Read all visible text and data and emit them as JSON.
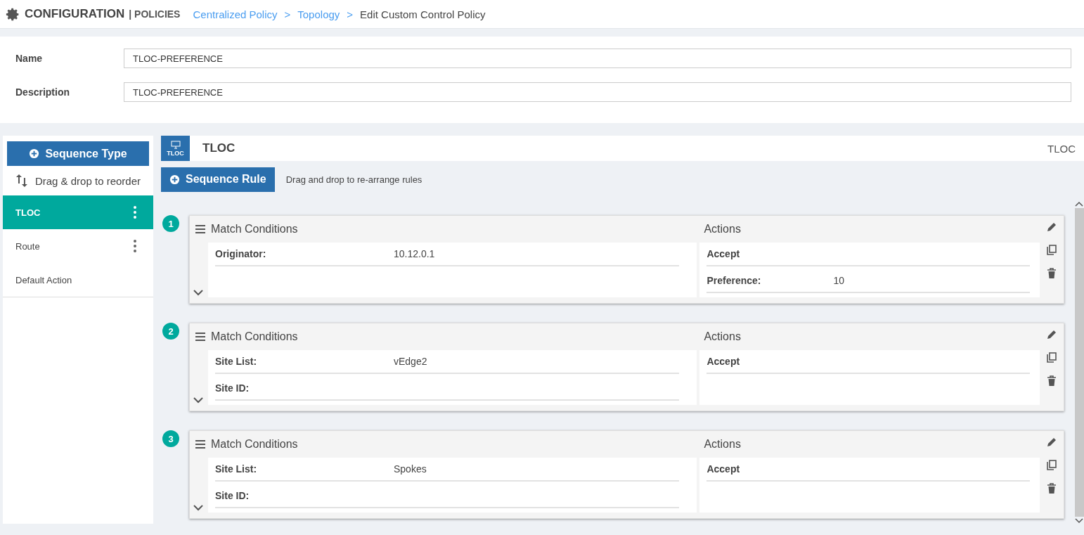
{
  "header": {
    "title": "CONFIGURATION",
    "section": "| POLICIES",
    "breadcrumbs": [
      {
        "label": "Centralized Policy",
        "kind": "link",
        "separator": ">"
      },
      {
        "label": "Topology",
        "kind": "link",
        "separator": ">"
      },
      {
        "label": "Edit Custom Control Policy",
        "kind": "current"
      }
    ]
  },
  "form": {
    "fields": [
      {
        "label": "Name",
        "value": "TLOC-PREFERENCE"
      },
      {
        "label": "Description",
        "value": "TLOC-PREFERENCE"
      }
    ]
  },
  "sidebar": {
    "add_button": "Sequence Type",
    "reorder_hint": "Drag & drop to reorder",
    "items": [
      {
        "label": "TLOC",
        "selected": true,
        "has_menu": true
      },
      {
        "label": "Route",
        "selected": false,
        "has_menu": true
      },
      {
        "label": "Default Action",
        "selected": false,
        "has_menu": false
      }
    ]
  },
  "panel": {
    "icon_label": "TLOC",
    "title": "TLOC",
    "type_label": "TLOC",
    "add_button": "Sequence Rule",
    "hint": "Drag and drop to re-arrange rules",
    "rules": [
      {
        "number": "1",
        "match_title": "Match Conditions",
        "actions_title": "Actions",
        "matches": [
          {
            "label": "Originator:",
            "value": "10.12.0.1"
          }
        ],
        "actions": [
          {
            "label": "Accept"
          },
          {
            "label": "Preference:",
            "value": "10"
          }
        ]
      },
      {
        "number": "2",
        "match_title": "Match Conditions",
        "actions_title": "Actions",
        "matches": [
          {
            "label": "Site List:",
            "value": "vEdge2"
          },
          {
            "label": "Site ID:"
          }
        ],
        "actions": [
          {
            "label": "Accept"
          }
        ]
      },
      {
        "number": "3",
        "match_title": "Match Conditions",
        "actions_title": "Actions",
        "matches": [
          {
            "label": "Site List:",
            "value": "Spokes"
          },
          {
            "label": "Site ID:"
          }
        ],
        "actions": [
          {
            "label": "Accept"
          }
        ]
      }
    ]
  }
}
